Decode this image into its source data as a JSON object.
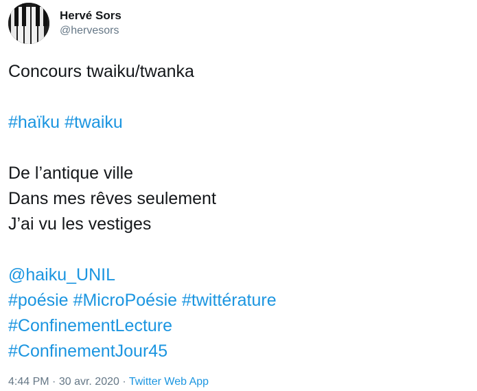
{
  "author": {
    "display_name": "Hervé Sors",
    "handle": "@hervesors"
  },
  "tweet": {
    "lines": [
      [
        {
          "text": "Concours twaiku/twanka",
          "kind": "text"
        }
      ],
      [],
      [
        {
          "text": "#haïku",
          "kind": "hashtag"
        },
        {
          "text": "#twaiku",
          "kind": "hashtag"
        }
      ],
      [],
      [
        {
          "text": "De l’antique ville",
          "kind": "text"
        }
      ],
      [
        {
          "text": "Dans mes rêves seulement",
          "kind": "text"
        }
      ],
      [
        {
          "text": "J’ai vu les vestiges",
          "kind": "text"
        }
      ],
      [],
      [
        {
          "text": "@haiku_UNIL",
          "kind": "mention"
        }
      ],
      [
        {
          "text": "#poésie",
          "kind": "hashtag"
        },
        {
          "text": "#MicroPoésie",
          "kind": "hashtag"
        },
        {
          "text": "#twittérature",
          "kind": "hashtag"
        }
      ],
      [
        {
          "text": "#ConfinementLecture",
          "kind": "hashtag"
        }
      ],
      [
        {
          "text": "#ConfinementJour45",
          "kind": "hashtag"
        }
      ]
    ]
  },
  "meta": {
    "time": "4:44 PM",
    "separator": "·",
    "date": "30 avr. 2020",
    "app": "Twitter Web App"
  },
  "colors": {
    "link": "#1b95e0",
    "muted": "#657786",
    "text": "#14171a"
  }
}
